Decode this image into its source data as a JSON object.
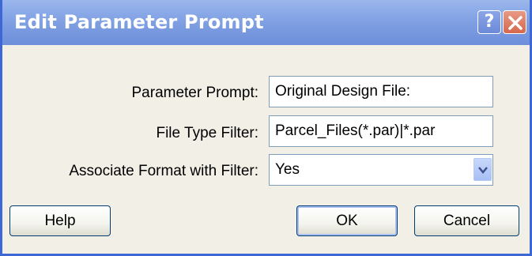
{
  "window": {
    "title": "Edit Parameter Prompt",
    "help_glyph": "?"
  },
  "form": {
    "parameter_prompt": {
      "label": "Parameter Prompt:",
      "value": "Original Design File:"
    },
    "file_type_filter": {
      "label": "File Type Filter:",
      "value": "Parcel_Files(*.par)|*.par"
    },
    "associate_format": {
      "label": "Associate Format with Filter:",
      "selected": "Yes"
    }
  },
  "buttons": {
    "help": "Help",
    "ok": "OK",
    "cancel": "Cancel"
  }
}
